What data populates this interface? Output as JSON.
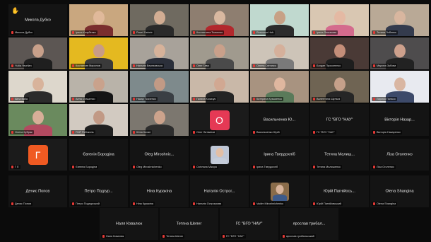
{
  "meeting": {
    "tiles": [
      {
        "id": "t1",
        "center_name": "Микола Дубко",
        "label": "Микола Дубко",
        "kind": "name"
      },
      {
        "id": "t2",
        "center_name": "",
        "label": "Ірина Козубенко",
        "kind": "video",
        "bg": "#c9a77f",
        "skin": "#e0b99a",
        "shirt": "#7a2e2e"
      },
      {
        "id": "t3",
        "center_name": "",
        "label": "Pavel Zadorin",
        "kind": "video",
        "bg": "#6f6a60",
        "skin": "#d2ad93",
        "shirt": "#2a2a2a"
      },
      {
        "id": "t4",
        "center_name": "",
        "label": "Костянтина Ткаченко",
        "kind": "video",
        "bg": "#8e7e70",
        "skin": "#d9b8a0",
        "shirt": "#b2282d"
      },
      {
        "id": "t5",
        "center_name": "",
        "label": "Resource Hub",
        "kind": "video",
        "bg": "#c0d9cf",
        "skin": "#c7a186",
        "shirt": "#2c2c2c"
      },
      {
        "id": "t6",
        "center_name": "",
        "label": "Ірина Лошакова",
        "kind": "video",
        "bg": "#d9c7b2",
        "skin": "#e4b9a3",
        "shirt": "#d46b8d"
      },
      {
        "id": "t7",
        "center_name": "",
        "label": "Тетяна Лобенко",
        "kind": "video",
        "bg": "#b9a996",
        "skin": "#d8b69f",
        "shirt": "#343b4d"
      },
      {
        "id": "t8",
        "center_name": "",
        "label": "Yuliia Yeprilan",
        "kind": "video",
        "bg": "#5c5653",
        "skin": "#c8a08a",
        "shirt": "#1f1f1f"
      },
      {
        "id": "t9",
        "center_name": "",
        "label": "Костянтин Миронов",
        "kind": "video",
        "bg": "#e4b920",
        "skin": "#c89c86",
        "shirt": "#3a3a3a"
      },
      {
        "id": "t10",
        "center_name": "",
        "label": "Наталія Березовська",
        "kind": "video",
        "bg": "#a8a29a",
        "skin": "#d6b29a",
        "shirt": "#2b2f3a"
      },
      {
        "id": "t11",
        "center_name": "",
        "label": "Олег Гава",
        "kind": "video",
        "bg": "#a09a8e",
        "skin": "#c9a08a",
        "shirt": "#4a4a4a"
      },
      {
        "id": "t12",
        "center_name": "",
        "label": "Олена Світанко",
        "kind": "video",
        "bg": "#cdc4b8",
        "skin": "#d5b09b",
        "shirt": "#7a7a7a"
      },
      {
        "id": "t13",
        "center_name": "",
        "label": "Богдан Прокопенко",
        "kind": "video",
        "bg": "#4a3a36",
        "skin": "#c48e79",
        "shirt": "#1e1e1e"
      },
      {
        "id": "t14",
        "center_name": "",
        "label": "Марина Зубова",
        "kind": "video",
        "bg": "#4e4c4d",
        "skin": "#cda08c",
        "shirt": "#222"
      },
      {
        "id": "t15",
        "center_name": "",
        "label": "Alina Baila",
        "kind": "video",
        "bg": "#ddd7cc",
        "skin": "#d8b39b",
        "shirt": "#2b2b2b"
      },
      {
        "id": "t16",
        "center_name": "",
        "label": "Анна Сташенко",
        "kind": "video",
        "bg": "#b9b3a9",
        "skin": "#c9a28c",
        "shirt": "#151515"
      },
      {
        "id": "t17",
        "center_name": "",
        "label": "Назар Ткаченко",
        "kind": "video",
        "bg": "#7e8a8c",
        "skin": "#c29a85",
        "shirt": "#3a3f44"
      },
      {
        "id": "t18",
        "center_name": "",
        "label": "Галина Козачук",
        "kind": "video",
        "bg": "#c9b8a8",
        "skin": "#d1a892",
        "shirt": "#242424"
      },
      {
        "id": "t19",
        "center_name": "",
        "label": "Катерина Кузьменко",
        "kind": "video",
        "bg": "#a89380",
        "skin": "#dfb79f",
        "shirt": "#5a7a5a"
      },
      {
        "id": "t20",
        "center_name": "",
        "label": "Валентина Шульга",
        "kind": "video",
        "bg": "#6f6453",
        "skin": "#c5a08a",
        "shirt": "#262626"
      },
      {
        "id": "t21",
        "center_name": "",
        "label": "Лариса Пальчо",
        "kind": "video",
        "bg": "#e8eaf0",
        "skin": "#d9b6a2",
        "shirt": "#3d4a6a"
      },
      {
        "id": "t22",
        "center_name": "",
        "label": "Олена Кубрак",
        "kind": "video",
        "bg": "#6a8a5e",
        "skin": "#d7ae98",
        "shirt": "#b34a60"
      },
      {
        "id": "t23",
        "center_name": "",
        "label": "FMP Рябоконь",
        "kind": "video",
        "bg": "#d2cac1",
        "skin": "#c19985",
        "shirt": "#202020"
      },
      {
        "id": "t24",
        "center_name": "",
        "label": "Юлія Кохан",
        "kind": "video",
        "bg": "#7c776f",
        "skin": "#cca38c",
        "shirt": "#2d2d2d"
      },
      {
        "id": "t25",
        "center_name": "",
        "label": "Олег Литвинов",
        "kind": "letter",
        "letter": "O",
        "color": "#e53955"
      },
      {
        "id": "t26",
        "center_name": "Васильченко Ю...",
        "label": "Васильченко Юрій",
        "kind": "name"
      },
      {
        "id": "t27",
        "center_name": "ГС \"ВГО \"НАУ\"",
        "label": "ГС \"ВГО \"НАУ\"",
        "kind": "name"
      },
      {
        "id": "t28",
        "center_name": "Вікторія Назар...",
        "label": "Вікторія Назаренко",
        "kind": "name"
      },
      {
        "id": "t29",
        "center_name": "",
        "label": "Г Е",
        "kind": "letter",
        "letter": "Г",
        "color": "#f05a22"
      },
      {
        "id": "t30",
        "center_name": "Євгенія Бородіна",
        "label": "Євгенія Бородіна",
        "kind": "name"
      },
      {
        "id": "t31",
        "center_name": "Oleg Miroshnic...",
        "label": "Oleg Miroshnichenko",
        "kind": "name"
      },
      {
        "id": "t32",
        "center_name": "",
        "label": "Світлана Мікора",
        "kind": "photo",
        "bg": "#bfc7d6",
        "skin": "#e2bfa6",
        "shirt": "#c5cdda"
      },
      {
        "id": "t33",
        "center_name": "Ірина Твердохліб",
        "label": "Ірина Твердохліб",
        "kind": "name"
      },
      {
        "id": "t34",
        "center_name": "Тетяна Малиш...",
        "label": "Тетяна Малишенко",
        "kind": "name"
      },
      {
        "id": "t35",
        "center_name": "Ліза Оголенко",
        "label": "Ліза Оголенко",
        "kind": "name"
      },
      {
        "id": "t36",
        "center_name": "Денис Попов",
        "label": "Денис Попов",
        "kind": "name"
      },
      {
        "id": "t37",
        "center_name": "Петро Подгур...",
        "label": "Петро Подгурський",
        "kind": "name"
      },
      {
        "id": "t38",
        "center_name": "Ніна Куракіна",
        "label": "Ніна Куракіна",
        "kind": "name"
      },
      {
        "id": "t39",
        "center_name": "Наталія Острог...",
        "label": "Наталія Острогрова",
        "kind": "name"
      },
      {
        "id": "t40",
        "center_name": "",
        "label": "Vadim Mirоshnichenko",
        "kind": "photo",
        "bg": "#8a6c4a",
        "skin": "#d8b39a",
        "shirt": "#3d5a8a"
      },
      {
        "id": "t41",
        "center_name": "Юрій Пагнійось...",
        "label": "Юрій Пагнійовський",
        "kind": "name"
      },
      {
        "id": "t42",
        "center_name": "Olena Shangina",
        "label": "Olena Shangina",
        "kind": "name"
      },
      {
        "id": "t43",
        "center_name": "Наля Ковалюк",
        "label": "Наля Ковалюк",
        "kind": "name"
      },
      {
        "id": "t44",
        "center_name": "Тетяна Шелег",
        "label": "Тетяна Шелег",
        "kind": "name"
      },
      {
        "id": "t45",
        "center_name": "ГС \"ВГО \"НАУ\"",
        "label": "ГС \"ВГО \"НАУ\"",
        "kind": "name"
      },
      {
        "id": "t46",
        "center_name": "ярослав трибал...",
        "label": "ярослав трибальський",
        "kind": "name"
      }
    ]
  }
}
